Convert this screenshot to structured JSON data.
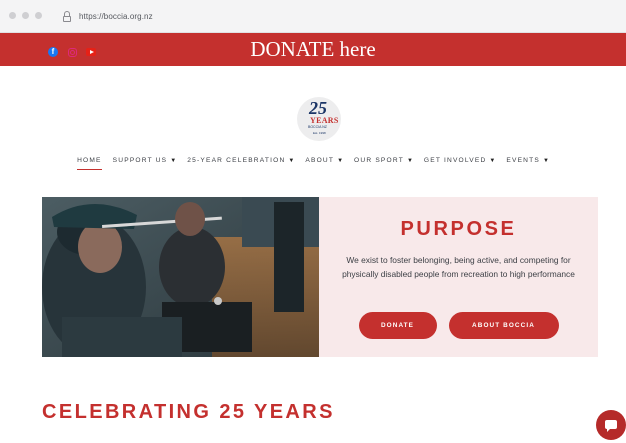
{
  "browser": {
    "url": "https://boccia.org.nz"
  },
  "banner": {
    "donate_label": "DONATE here"
  },
  "logo": {
    "number": "25",
    "years": "YEARS",
    "org": "BOCCIA NZ",
    "est": "Est. 1998"
  },
  "social": [
    "facebook-icon",
    "instagram-icon",
    "youtube-icon"
  ],
  "nav": {
    "items": [
      {
        "label": "HOME",
        "active": true,
        "dropdown": false
      },
      {
        "label": "SUPPORT US",
        "dropdown": true
      },
      {
        "label": "25-YEAR CELEBRATION",
        "dropdown": true
      },
      {
        "label": "ABOUT",
        "dropdown": true
      },
      {
        "label": "OUR SPORT",
        "dropdown": true
      },
      {
        "label": "GET INVOLVED",
        "dropdown": true
      },
      {
        "label": "EVENTS",
        "dropdown": true
      }
    ],
    "caret": "▼"
  },
  "hero": {
    "heading": "PURPOSE",
    "text": "We exist to foster belonging, being active, and competing for physically disabled people from recreation to high performance",
    "donate_button": "DONATE",
    "about_button": "ABOUT BOCCIA"
  },
  "section": {
    "heading": "CELEBRATING 25 YEARS"
  },
  "colors": {
    "accent": "#c4302e",
    "panel_bg": "#f8e9ea"
  }
}
